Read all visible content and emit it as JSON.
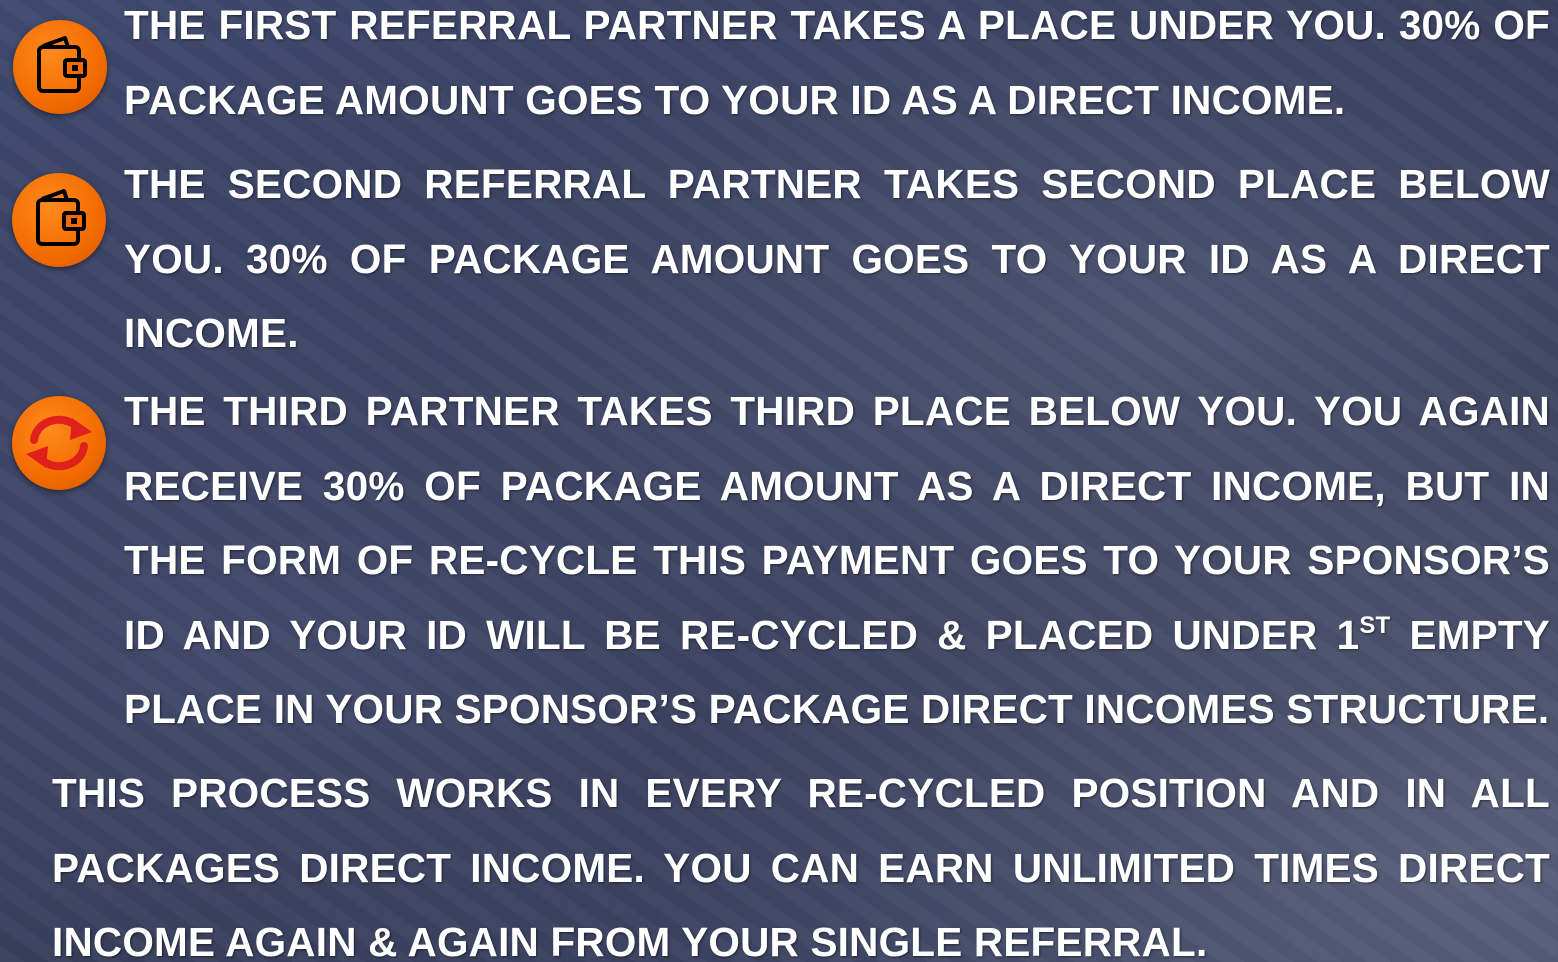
{
  "colors": {
    "icon_fill": "#f36b00",
    "text": "#ffffff",
    "background": "#3a4262"
  },
  "icons": [
    "wallet-icon",
    "wallet-icon",
    "recycle-icon"
  ],
  "paragraphs": {
    "first": "THE FIRST REFERRAL PARTNER TAKES A PLACE UNDER YOU.  30% OF PACKAGE AMOUNT  GOES TO YOUR ID AS A DIRECT INCOME.",
    "second": "THE SECOND REFERRAL PARTNER TAKES SECOND PLACE BELOW YOU. 30% OF PACKAGE AMOUNT  GOES TO YOUR ID AS A DIRECT INCOME.",
    "third_before": "THE THIRD PARTNER TAKES THIRD PLACE BELOW YOU. YOU AGAIN RECEIVE 30% OF PACKAGE AMOUNT AS A DIRECT INCOME, BUT IN THE FORM OF RE-CYCLE THIS PAYMENT GOES TO YOUR SPONSOR’S ID AND YOUR ID WILL BE RE-CYCLED & PLACED UNDER 1",
    "third_superscript": "ST",
    "third_after": " EMPTY PLACE IN YOUR SPONSOR’S PACKAGE DIRECT INCOMES STRUCTURE.",
    "summary": "THIS PROCESS WORKS IN EVERY RE-CYCLED POSITION AND IN ALL PACKAGES DIRECT INCOME. YOU CAN EARN UNLIMITED TIMES DIRECT INCOME AGAIN & AGAIN FROM YOUR SINGLE REFERRAL."
  }
}
